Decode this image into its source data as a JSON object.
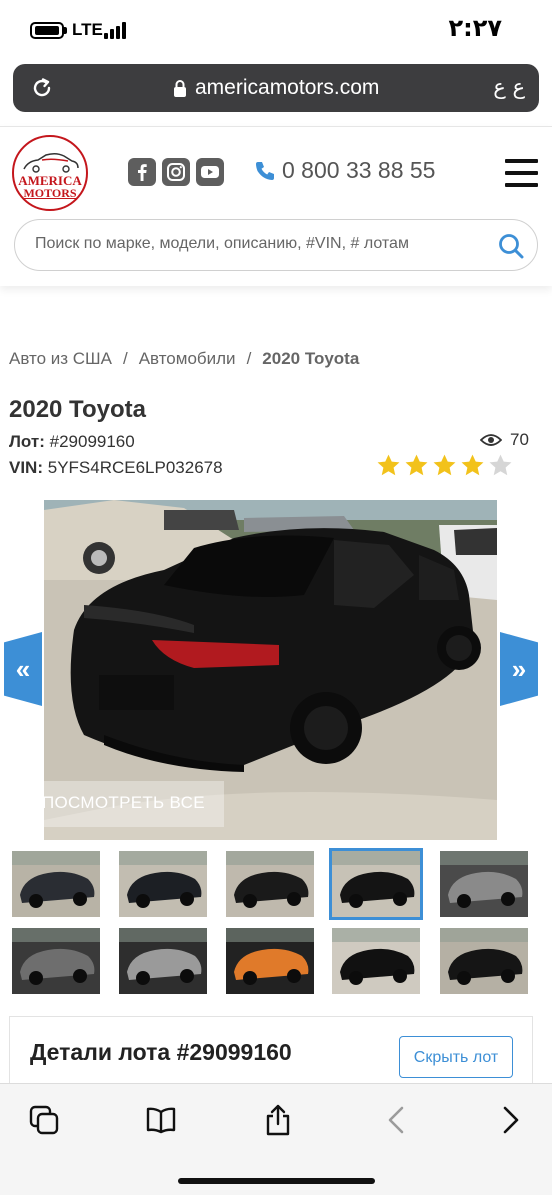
{
  "status_bar": {
    "network": "LTE",
    "time": "٢:٢٧"
  },
  "address_bar": {
    "url": "americamotors.com",
    "reader_label": "ع ع"
  },
  "site": {
    "logo_line1": "AMERICA",
    "logo_line2": "MOTORS",
    "phone": "0 800 33 88 55",
    "search_placeholder": "Поиск по марке, модели, описанию, #VIN, # лотам"
  },
  "breadcrumb": {
    "items": [
      "Авто из США",
      "Автомобили",
      "2020 Toyota"
    ],
    "separator": "/"
  },
  "listing": {
    "title": "2020 Toyota",
    "lot_label": "Лот:",
    "lot_value": "#29099160",
    "vin_label": "VIN:",
    "vin_value": "5YFS4RCE6LP032678",
    "views": "70",
    "rating": 4,
    "rating_max": 5
  },
  "gallery": {
    "view_all_label": "ПОСМОТРЕТЬ ВСЕ",
    "prev_label": "«",
    "next_label": "»",
    "selected_thumbnail": 4,
    "thumbnails": [
      "front-left view",
      "front view",
      "rear-left damaged view",
      "rear view",
      "interior front seats",
      "interior rear seats",
      "engine bay",
      "instrument cluster",
      "cable on ground",
      "left side view"
    ]
  },
  "details": {
    "heading": "Детали лота #29099160",
    "button_label": "Скрыть лот"
  },
  "colors": {
    "accent_blue": "#3d8fd6",
    "logo_red": "#c4161c",
    "star_yellow": "#f2c21b",
    "star_grey": "#d6d6d6",
    "url_bar": "#3d3d3f"
  },
  "toolbar": {
    "icons": [
      "tabs-icon",
      "bookmarks-icon",
      "share-icon",
      "back-icon",
      "forward-icon"
    ]
  }
}
